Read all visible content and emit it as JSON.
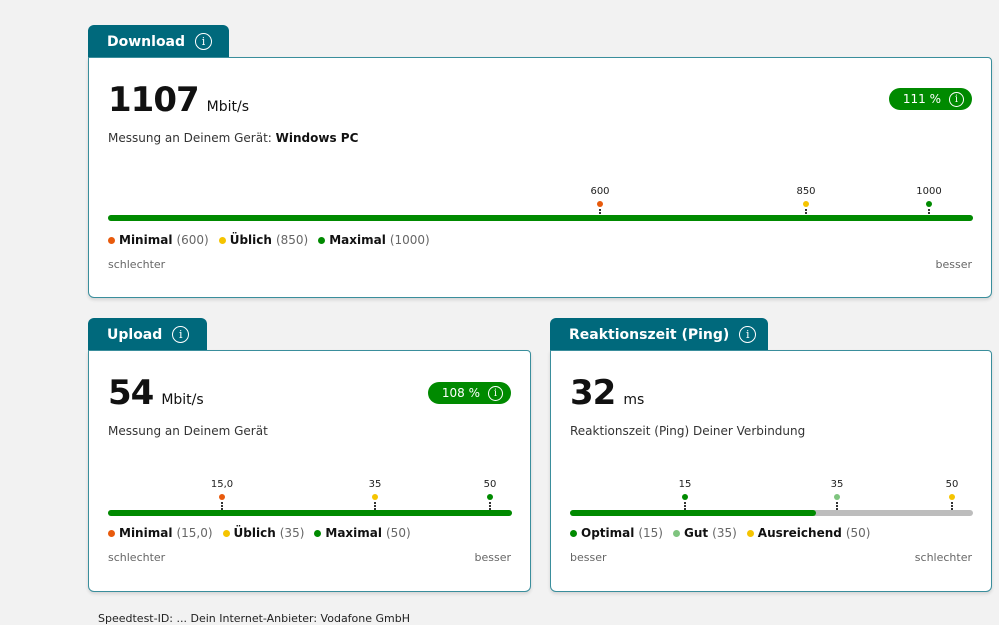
{
  "download": {
    "title": "Download",
    "value": "1107",
    "unit": "Mbit/s",
    "sub_prefix": "Messung an Deinem Gerät:",
    "device": "Windows PC",
    "badge": "111 %",
    "fill_percent": 100,
    "markers": [
      {
        "label": "600",
        "color": "#e85a0c"
      },
      {
        "label": "850",
        "color": "#f5c400"
      },
      {
        "label": "1000",
        "color": "#008a00"
      }
    ],
    "legend": [
      {
        "name": "Minimal",
        "val": "(600)",
        "color": "#e85a0c"
      },
      {
        "name": "Üblich",
        "val": "(850)",
        "color": "#f5c400"
      },
      {
        "name": "Maximal",
        "val": "(1000)",
        "color": "#008a00"
      }
    ],
    "left": "schlechter",
    "right": "besser"
  },
  "upload": {
    "title": "Upload",
    "value": "54",
    "unit": "Mbit/s",
    "sub": "Messung an Deinem Gerät",
    "badge": "108 %",
    "fill_percent": 100,
    "markers": [
      {
        "label": "15,0",
        "color": "#e85a0c"
      },
      {
        "label": "35",
        "color": "#f5c400"
      },
      {
        "label": "50",
        "color": "#008a00"
      }
    ],
    "legend": [
      {
        "name": "Minimal",
        "val": "(15,0)",
        "color": "#e85a0c"
      },
      {
        "name": "Üblich",
        "val": "(35)",
        "color": "#f5c400"
      },
      {
        "name": "Maximal",
        "val": "(50)",
        "color": "#008a00"
      }
    ],
    "left": "schlechter",
    "right": "besser"
  },
  "ping": {
    "title": "Reaktionszeit (Ping)",
    "value": "32",
    "unit": "ms",
    "sub": "Reaktionszeit (Ping) Deiner Verbindung",
    "fill_percent": 61,
    "markers": [
      {
        "label": "15",
        "color": "#008a00"
      },
      {
        "label": "35",
        "color": "#7fc47f"
      },
      {
        "label": "50",
        "color": "#f5c400"
      }
    ],
    "legend": [
      {
        "name": "Optimal",
        "val": "(15)",
        "color": "#008a00"
      },
      {
        "name": "Gut",
        "val": "(35)",
        "color": "#7fc47f"
      },
      {
        "name": "Ausreichend",
        "val": "(50)",
        "color": "#f5c400"
      }
    ],
    "left": "besser",
    "right": "schlechter"
  },
  "footer": "Speedtest-ID: ... Dein Internet-Anbieter: Vodafone GmbH"
}
